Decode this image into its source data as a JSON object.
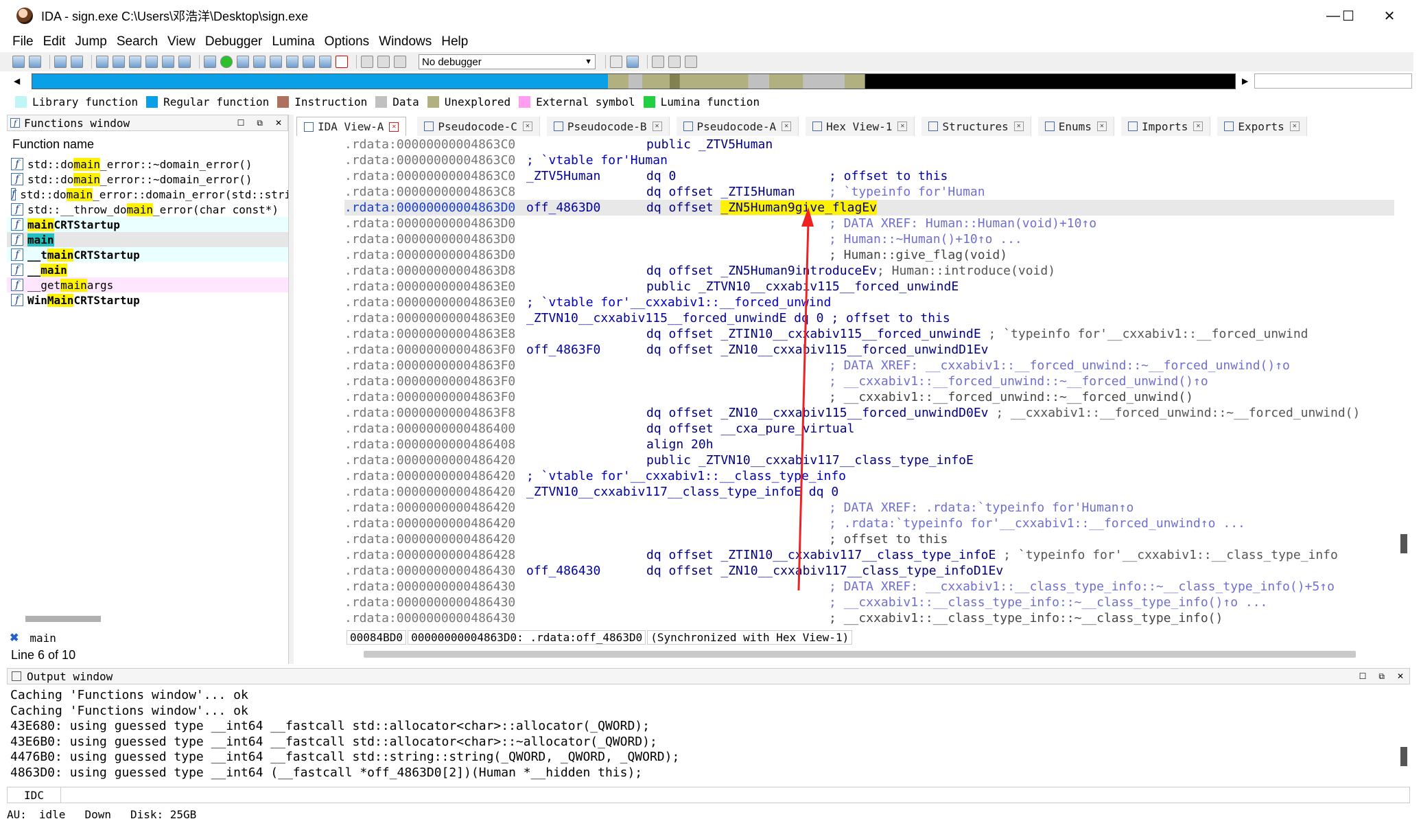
{
  "window": {
    "title": "IDA - sign.exe C:\\Users\\邓浩洋\\Desktop\\sign.exe",
    "minimize": "—",
    "maximize": "☐",
    "close": "✕"
  },
  "menu": [
    "File",
    "Edit",
    "Jump",
    "Search",
    "View",
    "Debugger",
    "Lumina",
    "Options",
    "Windows",
    "Help"
  ],
  "toolbar": {
    "debugger_select": "No debugger"
  },
  "legend": [
    {
      "label": "Library function",
      "color": "#bff5f5"
    },
    {
      "label": "Regular function",
      "color": "#0aa0e8"
    },
    {
      "label": "Instruction",
      "color": "#b07060"
    },
    {
      "label": "Data",
      "color": "#c0c0c0"
    },
    {
      "label": "Unexplored",
      "color": "#b0b080"
    },
    {
      "label": "External symbol",
      "color": "#ff9ef0"
    },
    {
      "label": "Lumina function",
      "color": "#20d040"
    }
  ],
  "functions_window": {
    "title": "Functions window",
    "column": "Function name",
    "filter": "main",
    "status": "Line 6 of 10",
    "items": [
      {
        "pre": "std::do",
        "hl": "main",
        "post": "_error::~domain_error()",
        "bold": false,
        "bg": ""
      },
      {
        "pre": "std::do",
        "hl": "main",
        "post": "_error::~domain_error()",
        "bold": false,
        "bg": ""
      },
      {
        "pre": "std::do",
        "hl": "main",
        "post": "_error::domain_error(std::strir",
        "bold": false,
        "bg": ""
      },
      {
        "pre": "std::__throw_do",
        "hl": "main",
        "post": "_error(char const*)",
        "bold": false,
        "bg": ""
      },
      {
        "pre": "",
        "hl": "main",
        "post": "CRTStartup",
        "bold": true,
        "bg": "#eaffff"
      },
      {
        "pre": "",
        "hl": "main",
        "post": "",
        "bold": true,
        "bg": "#e6e6e6",
        "hl_color": "#20c0c0"
      },
      {
        "pre": "__t",
        "hl": "main",
        "post": "CRTStartup",
        "bold": true,
        "bg": "#eaffff"
      },
      {
        "pre": "__",
        "hl": "main",
        "post": "",
        "bold": true,
        "bg": "#ffffff"
      },
      {
        "pre": "__get",
        "hl": "main",
        "post": "args",
        "bold": false,
        "bg": "#ffe6ff"
      },
      {
        "pre": "WinMain",
        "hl": "Main",
        "post": "CRTStartup",
        "bold": true,
        "bg": "#ffffff",
        "pre_plain": "Win",
        "mid": "Main",
        "post2": "CRTStartup"
      }
    ]
  },
  "tabs": [
    {
      "label": "IDA View-A",
      "active": true
    },
    {
      "label": "Pseudocode-C",
      "active": false
    },
    {
      "label": "Pseudocode-B",
      "active": false
    },
    {
      "label": "Pseudocode-A",
      "active": false
    },
    {
      "label": "Hex View-1",
      "active": false
    },
    {
      "label": "Structures",
      "active": false
    },
    {
      "label": "Enums",
      "active": false
    },
    {
      "label": "Imports",
      "active": false
    },
    {
      "label": "Exports",
      "active": false
    }
  ],
  "disasm": [
    {
      "addr": ".rdata:00000000004863C0",
      "label": "",
      "instr": "public _ZTV5Human",
      "comment": "",
      "dot": false
    },
    {
      "addr": ".rdata:00000000004863C0",
      "label": "; `vtable for'Human",
      "instr": "",
      "comment": "",
      "dot": false
    },
    {
      "addr": ".rdata:00000000004863C0",
      "label": "_ZTV5Human",
      "instr": "dq 0",
      "comment": "; offset to this",
      "dot": true
    },
    {
      "addr": ".rdata:00000000004863C8",
      "label": "",
      "instr": "dq offset _ZTI5Human",
      "comment": "; `typeinfo for'Human",
      "dot": true
    },
    {
      "addr": ".rdata:00000000004863D0",
      "label": "off_4863D0",
      "instr": "dq offset ",
      "instr_hl": "_ZN5Human9give_flagEv",
      "comment": "",
      "dot": true,
      "current": true
    },
    {
      "addr": ".rdata:00000000004863D0",
      "label": "",
      "instr": "",
      "comment": "; DATA XREF: Human::Human(void)+10↑o",
      "dot": false
    },
    {
      "addr": ".rdata:00000000004863D0",
      "label": "",
      "instr": "",
      "comment": "; Human::~Human()+10↑o ...",
      "dot": false
    },
    {
      "addr": ".rdata:00000000004863D0",
      "label": "",
      "instr": "",
      "comment": "; Human::give_flag(void)",
      "dot": false,
      "gray": true
    },
    {
      "addr": ".rdata:00000000004863D8",
      "label": "",
      "instr": "dq offset _ZN5Human9introduceEv",
      "comment": "; Human::introduce(void)",
      "dot": true,
      "comment_inline": true
    },
    {
      "addr": ".rdata:00000000004863E0",
      "label": "",
      "instr": "public _ZTVN10__cxxabiv115__forced_unwindE",
      "comment": "",
      "dot": false
    },
    {
      "addr": ".rdata:00000000004863E0",
      "label": "; `vtable for'__cxxabiv1::__forced_unwind",
      "instr": "",
      "comment": "",
      "dot": false
    },
    {
      "addr": ".rdata:00000000004863E0",
      "label": "_ZTVN10__cxxabiv115__forced_unwindE dq 0 ; offset to this",
      "instr": "",
      "comment": "",
      "dot": true
    },
    {
      "addr": ".rdata:00000000004863E8",
      "label": "",
      "instr": "dq offset _ZTIN10__cxxabiv115__forced_unwindE",
      "comment": " ; `typeinfo for'__cxxabiv1::__forced_unwind",
      "dot": true,
      "comment_inline": true
    },
    {
      "addr": ".rdata:00000000004863F0",
      "label": "off_4863F0",
      "instr": "dq offset _ZN10__cxxabiv115__forced_unwindD1Ev",
      "comment": "",
      "dot": true
    },
    {
      "addr": ".rdata:00000000004863F0",
      "label": "",
      "instr": "",
      "comment": "; DATA XREF: __cxxabiv1::__forced_unwind::~__forced_unwind()↑o",
      "dot": false
    },
    {
      "addr": ".rdata:00000000004863F0",
      "label": "",
      "instr": "",
      "comment": "; __cxxabiv1::__forced_unwind::~__forced_unwind()↑o",
      "dot": false
    },
    {
      "addr": ".rdata:00000000004863F0",
      "label": "",
      "instr": "",
      "comment": "; __cxxabiv1::__forced_unwind::~__forced_unwind()",
      "dot": false,
      "gray": true
    },
    {
      "addr": ".rdata:00000000004863F8",
      "label": "",
      "instr": "dq offset _ZN10__cxxabiv115__forced_unwindD0Ev",
      "comment": " ; __cxxabiv1::__forced_unwind::~__forced_unwind()",
      "dot": true,
      "comment_inline": true
    },
    {
      "addr": ".rdata:0000000000486400",
      "label": "",
      "instr": "dq offset __cxa_pure_virtual",
      "comment": "",
      "dot": true
    },
    {
      "addr": ".rdata:0000000000486408",
      "label": "",
      "instr": "align 20h",
      "comment": "",
      "dot": false
    },
    {
      "addr": ".rdata:0000000000486420",
      "label": "",
      "instr": "public _ZTVN10__cxxabiv117__class_type_infoE",
      "comment": "",
      "dot": false
    },
    {
      "addr": ".rdata:0000000000486420",
      "label": "; `vtable for'__cxxabiv1::__class_type_info",
      "instr": "",
      "comment": "",
      "dot": false
    },
    {
      "addr": ".rdata:0000000000486420",
      "label": "_ZTVN10__cxxabiv117__class_type_infoE dq 0",
      "instr": "",
      "comment": "",
      "dot": true
    },
    {
      "addr": ".rdata:0000000000486420",
      "label": "",
      "instr": "",
      "comment": "; DATA XREF: .rdata:`typeinfo for'Human↑o",
      "dot": false
    },
    {
      "addr": ".rdata:0000000000486420",
      "label": "",
      "instr": "",
      "comment": "; .rdata:`typeinfo for'__cxxabiv1::__forced_unwind↑o ...",
      "dot": false
    },
    {
      "addr": ".rdata:0000000000486420",
      "label": "",
      "instr": "",
      "comment": "; offset to this",
      "dot": false,
      "gray": true
    },
    {
      "addr": ".rdata:0000000000486428",
      "label": "",
      "instr": "dq offset _ZTIN10__cxxabiv117__class_type_infoE",
      "comment": " ; `typeinfo for'__cxxabiv1::__class_type_info",
      "dot": true,
      "comment_inline": true
    },
    {
      "addr": ".rdata:0000000000486430",
      "label": "off_486430",
      "instr": "dq offset _ZN10__cxxabiv117__class_type_infoD1Ev",
      "comment": "",
      "dot": true
    },
    {
      "addr": ".rdata:0000000000486430",
      "label": "",
      "instr": "",
      "comment": "; DATA XREF: __cxxabiv1::__class_type_info::~__class_type_info()+5↑o",
      "dot": false
    },
    {
      "addr": ".rdata:0000000000486430",
      "label": "",
      "instr": "",
      "comment": "; __cxxabiv1::__class_type_info::~__class_type_info()↑o ...",
      "dot": false
    },
    {
      "addr": ".rdata:0000000000486430",
      "label": "",
      "instr": "",
      "comment": "; __cxxabiv1::__class_type_info::~__class_type_info()",
      "dot": false,
      "gray": true
    }
  ],
  "disasm_status": [
    "00084BD0",
    "00000000004863D0: .rdata:off_4863D0",
    "(Synchronized with Hex View-1)"
  ],
  "output_window": {
    "title": "Output window",
    "lines": [
      "Caching 'Functions window'... ok",
      "Caching 'Functions window'... ok",
      "43E680: using guessed type __int64 __fastcall std::allocator<char>::allocator(_QWORD);",
      "43E6B0: using guessed type __int64 __fastcall std::allocator<char>::~allocator(_QWORD);",
      "4476B0: using guessed type __int64 __fastcall std::string::string(_QWORD, _QWORD, _QWORD);",
      "4863D0: using guessed type __int64 (__fastcall *off_4863D0[2])(Human *__hidden this);"
    ]
  },
  "idc": {
    "label": "IDC"
  },
  "statusbar": {
    "au": "AU:",
    "state": "idle",
    "direction": "Down",
    "disk": "Disk: 25GB"
  },
  "colors": {
    "arrow": "#ee2222",
    "highlight": "#fff200"
  },
  "icons": {
    "functions": "function-icon",
    "close": "close-icon"
  }
}
